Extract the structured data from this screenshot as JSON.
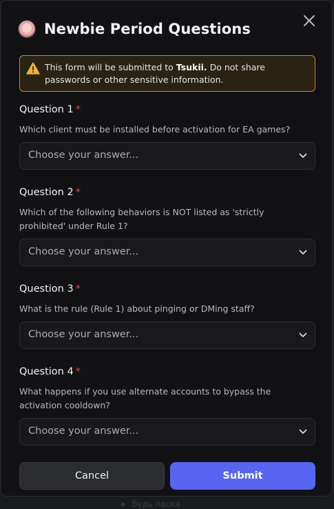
{
  "background": {
    "partial_text": "будь ласка"
  },
  "modal": {
    "title": "Newbie Period Questions",
    "close_icon": "close-icon"
  },
  "notice": {
    "icon": "warning-icon",
    "prefix": "This form will be submitted to ",
    "recipient": "Tsukii.",
    "suffix": " Do not share passwords or other sensitive information."
  },
  "questions": [
    {
      "label": "Question 1",
      "required_mark": "*",
      "text": "Which client must be installed before activation for EA games?",
      "placeholder": "Choose your answer..."
    },
    {
      "label": "Question 2",
      "required_mark": "*",
      "text": "Which of the following behaviors is NOT listed as 'strictly prohibited' under Rule 1?",
      "placeholder": "Choose your answer..."
    },
    {
      "label": "Question 3",
      "required_mark": "*",
      "text": "What is the rule (Rule 1) about pinging or DMing staff?",
      "placeholder": "Choose your answer..."
    },
    {
      "label": "Question 4",
      "required_mark": "*",
      "text": "What happens if you use alternate accounts to bypass the activation cooldown?",
      "placeholder": "Choose your answer..."
    }
  ],
  "buttons": {
    "cancel": "Cancel",
    "submit": "Submit"
  },
  "colors": {
    "accent": "#5865f2",
    "warning": "#f0b232",
    "required": "#f23f43"
  }
}
